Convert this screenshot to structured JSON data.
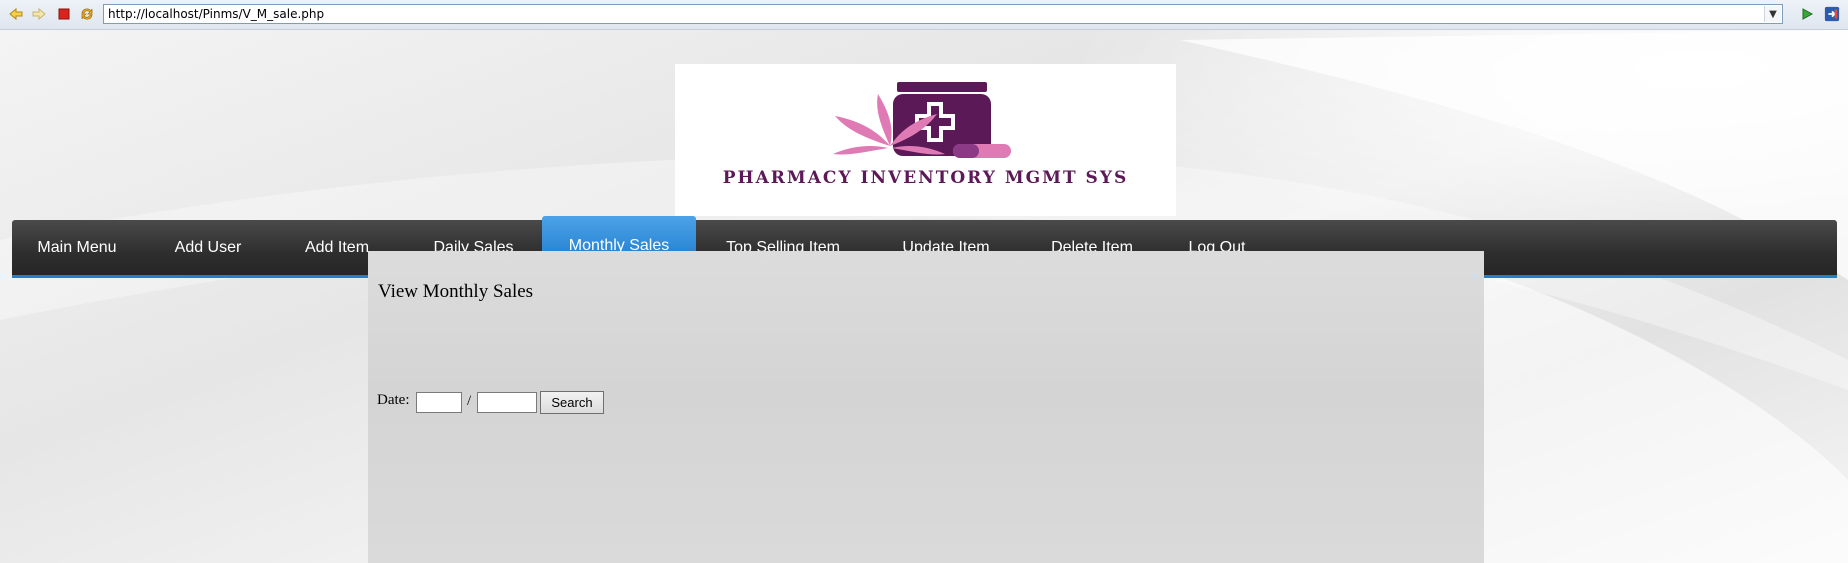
{
  "browser": {
    "back_icon": "back-arrow-icon",
    "forward_icon": "forward-arrow-icon",
    "stop_icon": "stop-icon",
    "refresh_icon": "refresh-icon",
    "url": "http://localhost/Pinms/V_M_sale.php",
    "go_icon": "go-arrow-icon",
    "exit_icon": "exit-icon"
  },
  "logo": {
    "title": "PHARMACY INVENTORY MGMT SYS",
    "colors": {
      "dark_purple": "#5b1a57",
      "pink": "#e07ab5"
    }
  },
  "nav": {
    "items": [
      {
        "label": "Main Menu",
        "active": false
      },
      {
        "label": "Add User",
        "active": false
      },
      {
        "label": "Add Item",
        "active": false
      },
      {
        "label": "Daily Sales",
        "active": false
      },
      {
        "label": "Monthly Sales",
        "active": true
      },
      {
        "label": "Top Selling Item",
        "active": false
      },
      {
        "label": "Update Item",
        "active": false
      },
      {
        "label": "Delete Item",
        "active": false
      },
      {
        "label": "Log Out",
        "active": false
      }
    ],
    "colors": {
      "bar": "#2e2e2e",
      "active": "#2a86d4",
      "text": "#ffffff"
    }
  },
  "content": {
    "title": "View Monthly Sales",
    "date_label": "Date:",
    "month_value": "",
    "separator": "/",
    "year_value": "",
    "search_label": "Search"
  }
}
